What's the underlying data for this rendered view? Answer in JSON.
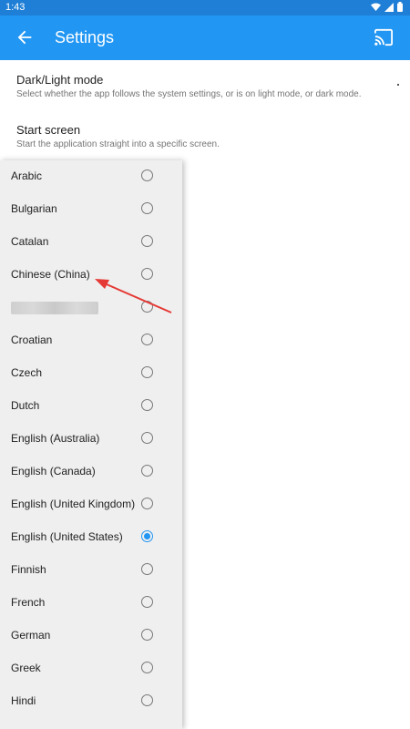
{
  "status": {
    "time": "1:43"
  },
  "header": {
    "title": "Settings"
  },
  "settings": [
    {
      "title": "Dark/Light mode",
      "subtitle": "Select whether the app follows the system settings, or is on light mode, or dark mode."
    },
    {
      "title": "Start screen",
      "subtitle": "Start the application straight into a specific screen."
    }
  ],
  "languages": [
    "Arabic",
    "Bulgarian",
    "Catalan",
    "Chinese (China)",
    "",
    "Croatian",
    "Czech",
    "Dutch",
    "English (Australia)",
    "English (Canada)",
    "English (United Kingdom)",
    "English (United States)",
    "Finnish",
    "French",
    "German",
    "Greek",
    "Hindi"
  ],
  "selected_language": "English (United States)",
  "colors": {
    "app_bar": "#2196f3",
    "status_bar": "#1f7fd6",
    "accent": "#2196f3",
    "annotation_arrow": "#e53935"
  },
  "icons": [
    "back-arrow-icon",
    "cast-icon",
    "wifi-icon",
    "signal-icon",
    "battery-icon"
  ]
}
